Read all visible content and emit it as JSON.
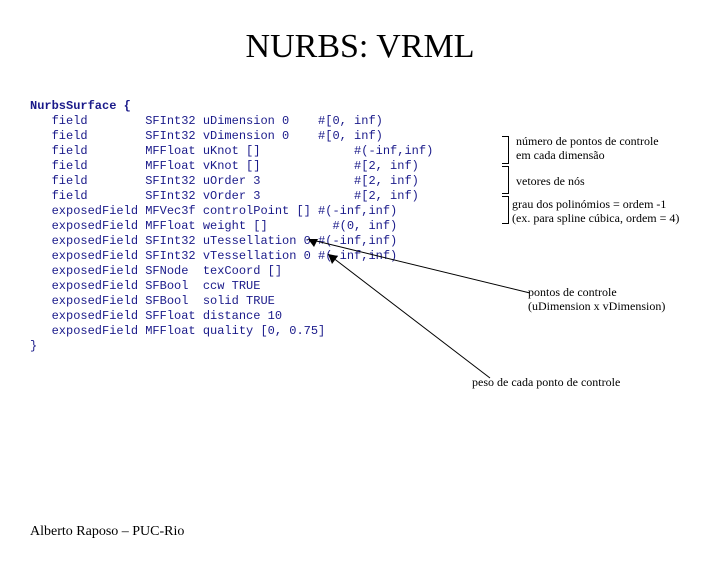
{
  "title": "NURBS: VRML",
  "code": {
    "header": "NurbsSurface {",
    "lines": [
      "   field        SFInt32 uDimension 0    #[0, inf)",
      "   field        SFInt32 vDimension 0    #[0, inf)",
      "   field        MFFloat uKnot []             #(-inf,inf)",
      "   field        MFFloat vKnot []             #[2, inf)",
      "   field        SFInt32 uOrder 3             #[2, inf)",
      "   field        SFInt32 vOrder 3             #[2, inf)",
      "   exposedField MFVec3f controlPoint [] #(-inf,inf)",
      "   exposedField MFFloat weight []         #(0, inf)",
      "   exposedField SFInt32 uTessellation 0 #(-inf,inf)",
      "   exposedField SFInt32 vTessellation 0 #(-inf,inf)",
      "   exposedField SFNode  texCoord []",
      "   exposedField SFBool  ccw TRUE",
      "   exposedField SFBool  solid TRUE",
      "   exposedField SFFloat distance 10",
      "   exposedField MFFloat quality [0, 0.75]",
      "}"
    ]
  },
  "notes": {
    "n1a": "número de pontos de controle",
    "n1b": "em cada dimensão",
    "n2": "vetores de nós",
    "n3a": "grau dos polinómios = ordem -1",
    "n3b": "(ex. para spline cúbica, ordem = 4)",
    "n4a": "pontos de controle",
    "n4b": "(uDimension x vDimension)",
    "n5": "peso de cada ponto de controle"
  },
  "footer": "Alberto Raposo – PUC-Rio"
}
